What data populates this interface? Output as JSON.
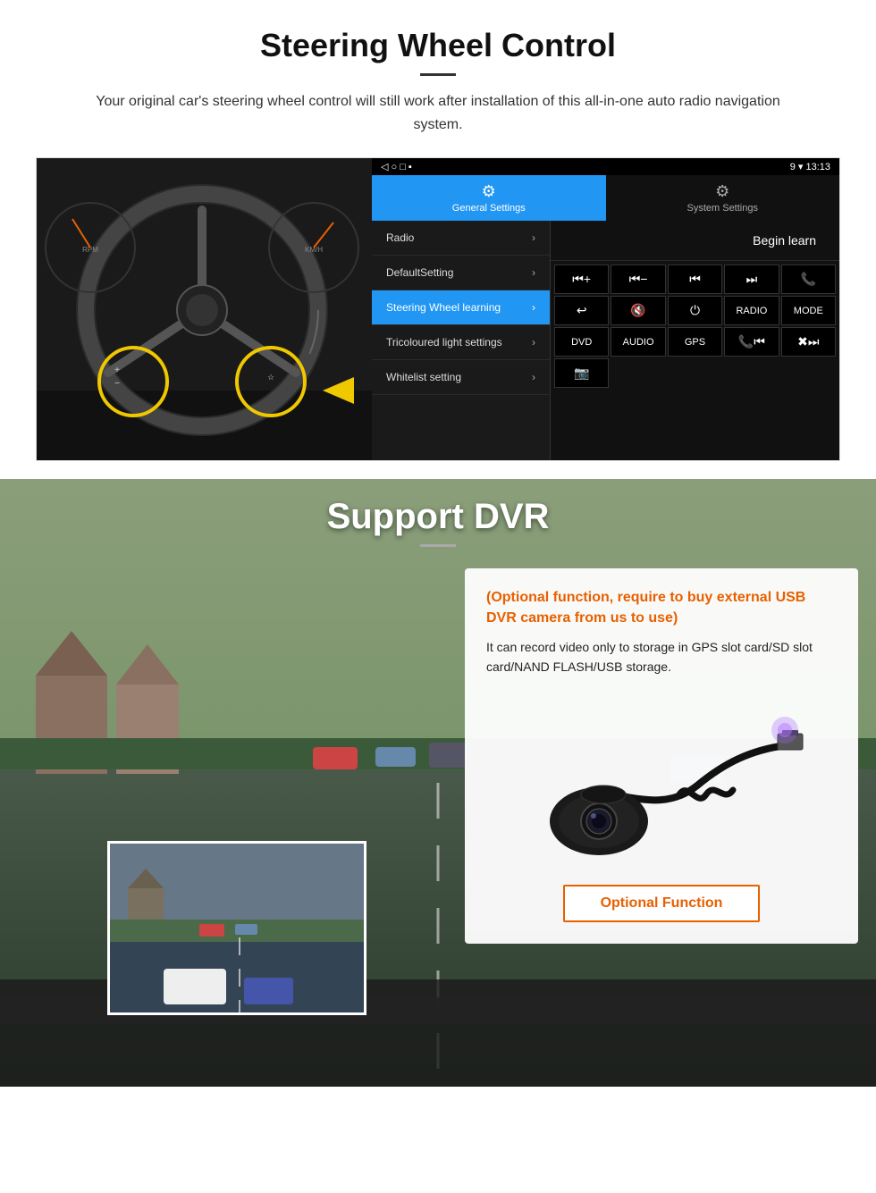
{
  "steering_section": {
    "title": "Steering Wheel Control",
    "subtitle": "Your original car's steering wheel control will still work after installation of this all-in-one auto radio navigation system.",
    "android_statusbar": {
      "nav_icons": "◁  ○  □  ▪",
      "status_icons": "9 ▾ 13:13"
    },
    "tabs": [
      {
        "id": "general",
        "icon": "⚙",
        "label": "General Settings",
        "active": true
      },
      {
        "id": "system",
        "icon": "🔧",
        "label": "System Settings",
        "active": false
      }
    ],
    "menu_items": [
      {
        "label": "Radio",
        "active": false
      },
      {
        "label": "DefaultSetting",
        "active": false
      },
      {
        "label": "Steering Wheel learning",
        "active": true
      },
      {
        "label": "Tricoloured light settings",
        "active": false
      },
      {
        "label": "Whitelist setting",
        "active": false
      }
    ],
    "begin_learn_label": "Begin learn",
    "control_buttons": [
      {
        "label": "⏮+",
        "row": 1
      },
      {
        "label": "⏮−",
        "row": 1
      },
      {
        "label": "⏮⏮",
        "row": 1
      },
      {
        "label": "⏭⏭",
        "row": 1
      },
      {
        "label": "☎",
        "row": 1
      },
      {
        "label": "↩",
        "row": 2
      },
      {
        "label": "🔇",
        "row": 2
      },
      {
        "label": "⏻",
        "row": 2
      },
      {
        "label": "RADIO",
        "row": 2
      },
      {
        "label": "MODE",
        "row": 2
      },
      {
        "label": "DVD",
        "row": 3
      },
      {
        "label": "AUDIO",
        "row": 3
      },
      {
        "label": "GPS",
        "row": 3
      },
      {
        "label": "📞⏮",
        "row": 3
      },
      {
        "label": "✖⏭",
        "row": 3
      },
      {
        "label": "📷",
        "row": 4
      }
    ]
  },
  "dvr_section": {
    "title": "Support DVR",
    "optional_title": "(Optional function, require to buy external USB DVR camera from us to use)",
    "desc": "It can record video only to storage in GPS slot card/SD slot card/NAND FLASH/USB storage.",
    "optional_function_btn": "Optional Function"
  }
}
